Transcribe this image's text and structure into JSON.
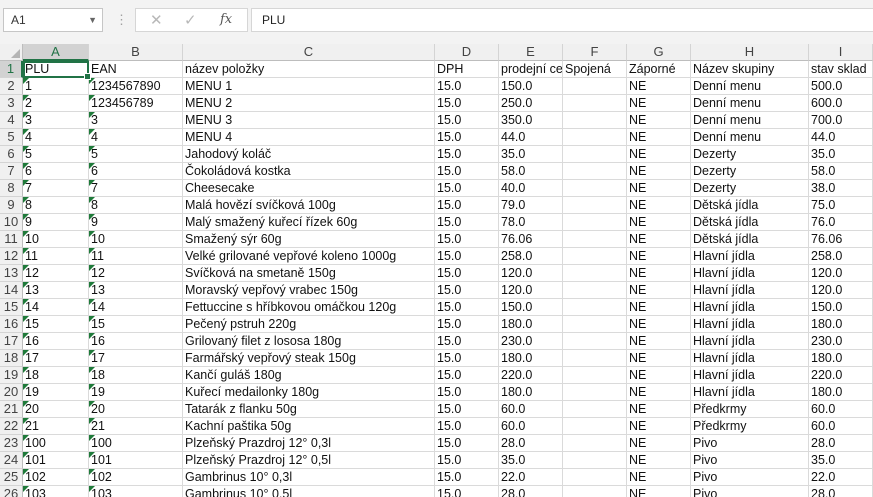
{
  "formula_bar": {
    "name_box": "A1",
    "cancel_icon": "✕",
    "enter_icon": "✓",
    "fx_label": "fx",
    "formula_value": "PLU"
  },
  "columns": [
    "A",
    "B",
    "C",
    "D",
    "E",
    "F",
    "G",
    "H",
    "I"
  ],
  "selected_cell": "A1",
  "rows": [
    {
      "n": "1",
      "cells": [
        "PLU",
        "EAN",
        "název položky",
        "DPH",
        "prodejní cena",
        "Spojená",
        "Záporné",
        "Název skupiny",
        "stav sklad"
      ]
    },
    {
      "n": "2",
      "cells": [
        "1",
        "1234567890",
        "MENU 1",
        "15.0",
        "150.0",
        "",
        "NE",
        "Denní menu",
        "500.0"
      ]
    },
    {
      "n": "3",
      "cells": [
        "2",
        "123456789",
        "MENU 2",
        "15.0",
        "250.0",
        "",
        "NE",
        "Denní menu",
        "600.0"
      ]
    },
    {
      "n": "4",
      "cells": [
        "3",
        "3",
        "MENU 3",
        "15.0",
        "350.0",
        "",
        "NE",
        "Denní menu",
        "700.0"
      ]
    },
    {
      "n": "5",
      "cells": [
        "4",
        "4",
        "MENU 4",
        "15.0",
        "44.0",
        "",
        "NE",
        "Denní menu",
        "44.0"
      ]
    },
    {
      "n": "6",
      "cells": [
        "5",
        "5",
        "Jahodový koláč",
        "15.0",
        "35.0",
        "",
        "NE",
        "Dezerty",
        "35.0"
      ]
    },
    {
      "n": "7",
      "cells": [
        "6",
        "6",
        "Čokoládová kostka",
        "15.0",
        "58.0",
        "",
        "NE",
        "Dezerty",
        "58.0"
      ]
    },
    {
      "n": "8",
      "cells": [
        "7",
        "7",
        "Cheesecake",
        "15.0",
        "40.0",
        "",
        "NE",
        "Dezerty",
        "38.0"
      ]
    },
    {
      "n": "9",
      "cells": [
        "8",
        "8",
        "Malá hovězí svíčková 100g",
        "15.0",
        "79.0",
        "",
        "NE",
        "Dětská jídla",
        "75.0"
      ]
    },
    {
      "n": "10",
      "cells": [
        "9",
        "9",
        "Malý smažený kuřecí řízek 60g",
        "15.0",
        "78.0",
        "",
        "NE",
        "Dětská jídla",
        "76.0"
      ]
    },
    {
      "n": "11",
      "cells": [
        "10",
        "10",
        "Smažený sýr 60g",
        "15.0",
        "76.06",
        "",
        "NE",
        "Dětská jídla",
        "76.06"
      ]
    },
    {
      "n": "12",
      "cells": [
        "11",
        "11",
        "Velké grilované vepřové koleno 1000g",
        "15.0",
        "258.0",
        "",
        "NE",
        "Hlavní jídla",
        "258.0"
      ]
    },
    {
      "n": "13",
      "cells": [
        "12",
        "12",
        "Svíčková na smetaně 150g",
        "15.0",
        "120.0",
        "",
        "NE",
        "Hlavní jídla",
        "120.0"
      ]
    },
    {
      "n": "14",
      "cells": [
        "13",
        "13",
        "Moravský vepřový vrabec 150g",
        "15.0",
        "120.0",
        "",
        "NE",
        "Hlavní jídla",
        "120.0"
      ]
    },
    {
      "n": "15",
      "cells": [
        "14",
        "14",
        "Fettuccine s hříbkovou omáčkou 120g",
        "15.0",
        "150.0",
        "",
        "NE",
        "Hlavní jídla",
        "150.0"
      ]
    },
    {
      "n": "16",
      "cells": [
        "15",
        "15",
        "Pečený pstruh 220g",
        "15.0",
        "180.0",
        "",
        "NE",
        "Hlavní jídla",
        "180.0"
      ]
    },
    {
      "n": "17",
      "cells": [
        "16",
        "16",
        "Grilovaný filet z lososa 180g",
        "15.0",
        "230.0",
        "",
        "NE",
        "Hlavní jídla",
        "230.0"
      ]
    },
    {
      "n": "18",
      "cells": [
        "17",
        "17",
        "Farmářský vepřový steak 150g",
        "15.0",
        "180.0",
        "",
        "NE",
        "Hlavní jídla",
        "180.0"
      ]
    },
    {
      "n": "19",
      "cells": [
        "18",
        "18",
        "Kančí guláš 180g",
        "15.0",
        "220.0",
        "",
        "NE",
        "Hlavní jídla",
        "220.0"
      ]
    },
    {
      "n": "20",
      "cells": [
        "19",
        "19",
        "Kuřecí medailonky 180g",
        "15.0",
        "180.0",
        "",
        "NE",
        "Hlavní jídla",
        "180.0"
      ]
    },
    {
      "n": "21",
      "cells": [
        "20",
        "20",
        "Tatarák z flanku 50g",
        "15.0",
        "60.0",
        "",
        "NE",
        "Předkrmy",
        "60.0"
      ]
    },
    {
      "n": "22",
      "cells": [
        "21",
        "21",
        "Kachní paštika 50g",
        "15.0",
        "60.0",
        "",
        "NE",
        "Předkrmy",
        "60.0"
      ]
    },
    {
      "n": "23",
      "cells": [
        "100",
        "100",
        "Plzeňský Prazdroj 12° 0,3l",
        "15.0",
        "28.0",
        "",
        "NE",
        "Pivo",
        "28.0"
      ]
    },
    {
      "n": "24",
      "cells": [
        "101",
        "101",
        "Plzeňský Prazdroj 12° 0,5l",
        "15.0",
        "35.0",
        "",
        "NE",
        "Pivo",
        "35.0"
      ]
    },
    {
      "n": "25",
      "cells": [
        "102",
        "102",
        "Gambrinus 10° 0,3l",
        "15.0",
        "22.0",
        "",
        "NE",
        "Pivo",
        "22.0"
      ]
    },
    {
      "n": "26",
      "cells": [
        "103",
        "103",
        "Gambrinus 10° 0,5l",
        "15.0",
        "28.0",
        "",
        "NE",
        "Pivo",
        "28.0"
      ]
    }
  ],
  "text_cells_with_indicator": [
    "A",
    "B"
  ],
  "colors": {
    "accent": "#217346",
    "indicator": "#1f7a3a"
  }
}
